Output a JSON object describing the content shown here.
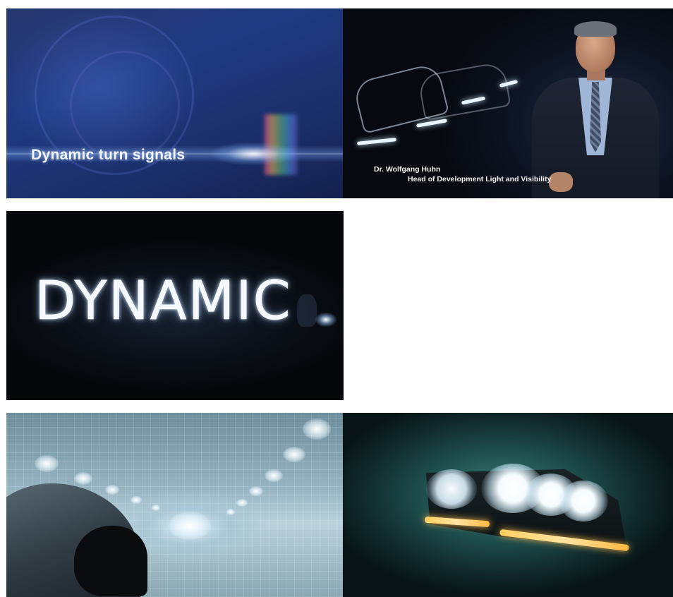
{
  "frames": [
    {
      "id": "frame-1",
      "title_text": "Dynamic turn signals"
    },
    {
      "id": "frame-2",
      "caption_name": "Dr. Wolfgang Huhn",
      "caption_role": "Head of Development Light and Visibility"
    },
    {
      "id": "frame-3",
      "light_word": "DYNAMIC"
    },
    {
      "id": "frame-4"
    },
    {
      "id": "frame-5"
    }
  ],
  "colors": {
    "page_background": "#ffffff",
    "title_card_blue": "#1f3a82",
    "caption_text": "#f3f3f3",
    "turn_signal_amber": "#ffcf60",
    "tunnel_cyan": "#b9d2db",
    "headlight_teal": "#3c7f7a"
  }
}
